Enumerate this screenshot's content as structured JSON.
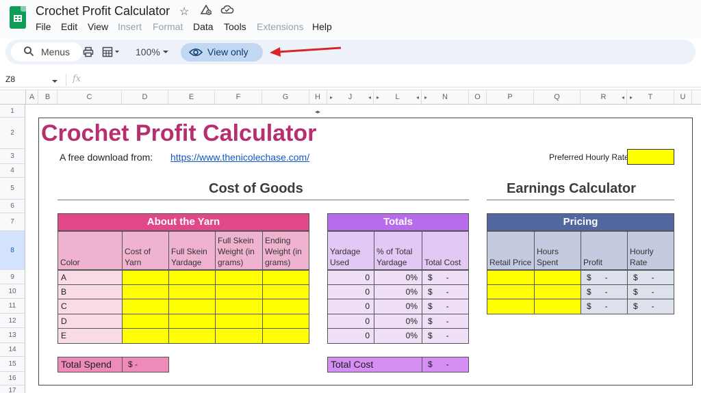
{
  "app": {
    "title": "Crochet Profit Calculator",
    "menus": [
      "File",
      "Edit",
      "View",
      "Insert",
      "Format",
      "Data",
      "Tools",
      "Extensions",
      "Help"
    ],
    "menus_disabled": [
      "Insert",
      "Format",
      "Extensions"
    ]
  },
  "toolbar": {
    "search_label": "Menus",
    "zoom": "100%",
    "view_only_label": "View only"
  },
  "formula_bar": {
    "cell_ref": "Z8",
    "fx_label": "fx"
  },
  "columns": [
    "A",
    "B",
    "C",
    "D",
    "E",
    "F",
    "G",
    "H",
    "J",
    "L",
    "N",
    "O",
    "P",
    "Q",
    "R",
    "T",
    "U"
  ],
  "rows": [
    "1",
    "2",
    "3",
    "4",
    "5",
    "6",
    "7",
    "8",
    "9",
    "10",
    "11",
    "12",
    "13",
    "14",
    "15",
    "16",
    "17"
  ],
  "sheet": {
    "title": "Crochet Profit Calculator",
    "download_label": "A free download from:",
    "download_url": "https://www.thenicolechase.com/",
    "hourly_rate_label": "Preferred Hourly Rate",
    "cost_section_title": "Cost of Goods",
    "earnings_section_title": "Earnings Calculator",
    "yarn_table": {
      "title": "About the Yarn",
      "headers": [
        "Color",
        "Cost of Yarn",
        "Full Skein Yardage",
        "Full Skein Weight (in grams)",
        "Ending Weight (in grams)"
      ],
      "rows": [
        "A",
        "B",
        "C",
        "D",
        "E"
      ]
    },
    "totals_table": {
      "title": "Totals",
      "headers": [
        "Yardage Used",
        "% of Total Yardage",
        "Total Cost"
      ],
      "rows": [
        {
          "yardage": "0",
          "pct": "0%",
          "cost": "$      -"
        },
        {
          "yardage": "0",
          "pct": "0%",
          "cost": "$      -"
        },
        {
          "yardage": "0",
          "pct": "0%",
          "cost": "$      -"
        },
        {
          "yardage": "0",
          "pct": "0%",
          "cost": "$      -"
        },
        {
          "yardage": "0",
          "pct": "0%",
          "cost": "$      -"
        }
      ]
    },
    "pricing_table": {
      "title": "Pricing",
      "headers": [
        "Retail Price",
        "Hours Spent",
        "Profit",
        "Hourly Rate"
      ],
      "rows": [
        {
          "profit": "$      -",
          "hourly": "$      -"
        },
        {
          "profit": "$      -",
          "hourly": "$      -"
        },
        {
          "profit": "$      -",
          "hourly": "$      -"
        }
      ]
    },
    "total_spend": {
      "label": "Total Spend",
      "value": "$      -"
    },
    "total_cost": {
      "label": "Total Cost",
      "value": "$      -"
    }
  },
  "colors": {
    "title_pink": "#b72f6e",
    "yarn_banner": "#e0488a",
    "yarn_header": "#f0b3cf",
    "yarn_body": "#f9dbe8",
    "totals_banner": "#b86bea",
    "totals_header": "#e2c8f5",
    "totals_body": "#efe0f8",
    "pricing_banner": "#52669f",
    "pricing_header": "#c4cbe0",
    "pricing_body": "#dde1ec",
    "input_yellow": "#ffff00",
    "view_only_bg": "#c2d7f2",
    "arrow_red": "#d9252a"
  }
}
